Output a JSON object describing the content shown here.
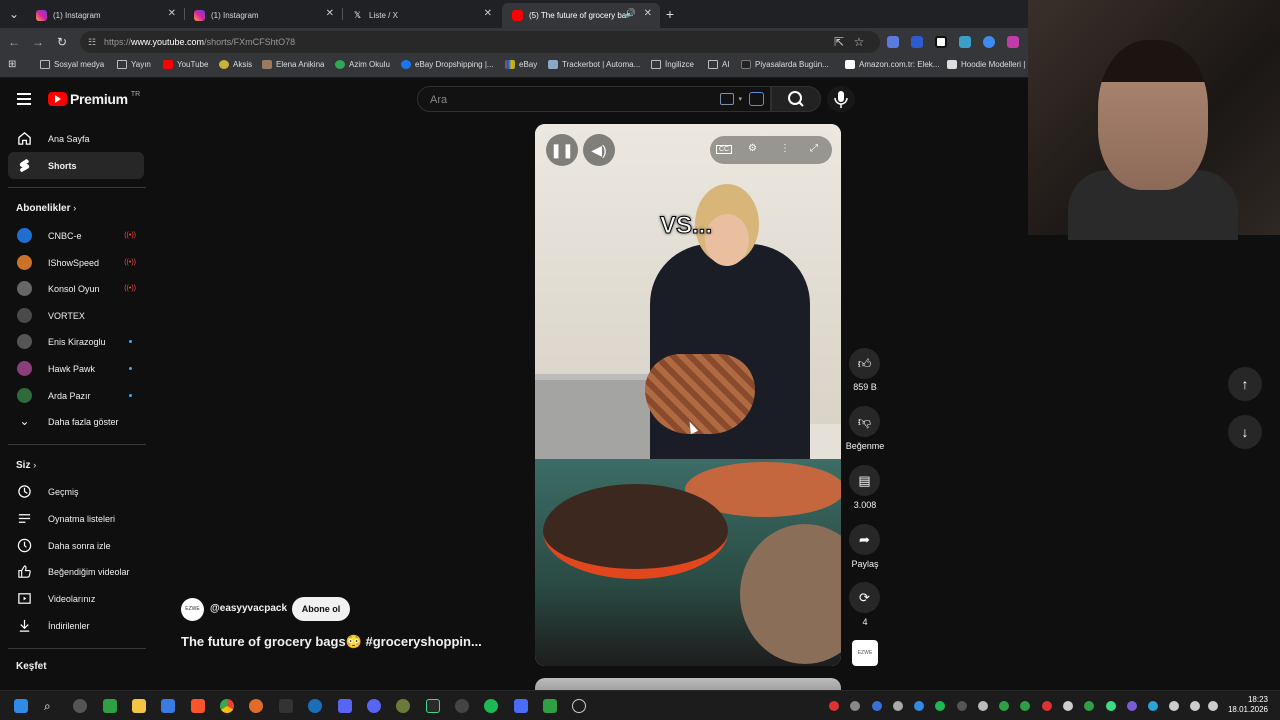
{
  "browser": {
    "tabs": [
      {
        "title": "(1) Instagram"
      },
      {
        "title": "(1) Instagram"
      },
      {
        "title": "Liste / X"
      },
      {
        "title": "(5) The future of grocery ba"
      }
    ],
    "new_tab": "+",
    "url_domain": "www.youtube.com",
    "url_prefix": "https://",
    "url_path": "/shorts/FXmCFShtO78",
    "bookmarks": [
      {
        "label": "Sosyal medya",
        "icon": "folder-icon"
      },
      {
        "label": "Yayın",
        "icon": "folder-icon"
      },
      {
        "label": "YouTube",
        "icon": "youtube-icon"
      },
      {
        "label": "Aksis",
        "icon": "aksis-icon"
      },
      {
        "label": "Elena Anikina",
        "icon": "person-icon"
      },
      {
        "label": "Azim Okulu",
        "icon": "azim-icon"
      },
      {
        "label": "eBay Dropshipping |...",
        "icon": "facebook-icon"
      },
      {
        "label": "eBay",
        "icon": "ebay-icon"
      },
      {
        "label": "Trackerbot | Automa...",
        "icon": "trackerbot-icon"
      },
      {
        "label": "İngilizce",
        "icon": "folder-icon"
      },
      {
        "label": "AI",
        "icon": "folder-icon"
      },
      {
        "label": "Piyasalarda Bugün...",
        "icon": "news-icon"
      },
      {
        "label": "Amazon.com.tr: Elek...",
        "icon": "amazon-icon"
      },
      {
        "label": "Hoodie Modelleri |",
        "icon": "shop-icon"
      }
    ]
  },
  "youtube": {
    "logo_text": "Premium",
    "logo_region": "TR",
    "search_placeholder": "Ara",
    "sidebar": {
      "main": [
        {
          "label": "Ana Sayfa",
          "icon": "home-icon"
        },
        {
          "label": "Shorts",
          "icon": "shorts-icon"
        }
      ],
      "subs_header": "Abonelikler",
      "subs": [
        {
          "label": "CNBC-e",
          "status": "live",
          "color": "#1f6fd1"
        },
        {
          "label": "IShowSpeed",
          "status": "live",
          "color": "#c8722a"
        },
        {
          "label": "Konsol Oyun",
          "status": "live",
          "color": "#666666"
        },
        {
          "label": "VORTEX",
          "status": "",
          "color": "#4a4a4a"
        },
        {
          "label": "Enis Kirazoglu",
          "status": "new",
          "color": "#555555"
        },
        {
          "label": "Hawk Pawk",
          "status": "new",
          "color": "#8a3f7a"
        },
        {
          "label": "Arda Pazır",
          "status": "new",
          "color": "#2f6b3a"
        }
      ],
      "show_more": "Daha fazla göster",
      "you_header": "Siz",
      "you": [
        {
          "label": "Geçmiş",
          "icon": "history-icon"
        },
        {
          "label": "Oynatma listeleri",
          "icon": "playlist-icon"
        },
        {
          "label": "Daha sonra izle",
          "icon": "clock-icon"
        },
        {
          "label": "Beğendiğim videolar",
          "icon": "thumbs-up-icon"
        },
        {
          "label": "Videolarınız",
          "icon": "video-icon"
        },
        {
          "label": "İndirilenler",
          "icon": "download-icon"
        }
      ],
      "explore_header": "Keşfet"
    },
    "short": {
      "overlay_text": "VS...",
      "channel_avatar_text": "EZWE",
      "channel": "@easyyvacpack",
      "subscribe": "Abone ol",
      "title": "The future of grocery bags😳  #groceryshoppin..."
    },
    "actions": {
      "likes": "859 B",
      "dislike": "Beğenme",
      "comments": "3.008",
      "share": "Paylaş",
      "remix": "4"
    }
  },
  "taskbar": {
    "time": "18:23",
    "date": "18.01.2026"
  }
}
